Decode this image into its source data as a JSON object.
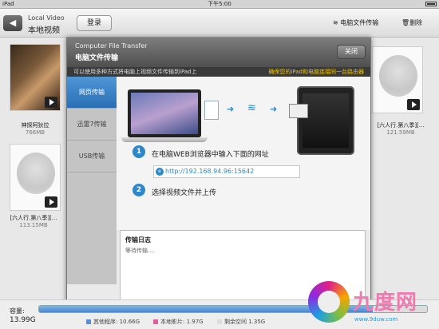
{
  "status_bar": {
    "device": "iPad",
    "time": "下午5:00"
  },
  "header": {
    "back_icon": "back-arrow-icon",
    "subtitle": "Local Video",
    "title": "本地视频",
    "login_label": "登录",
    "pc_transfer_label": "电脑文件传输",
    "delete_label": "删除"
  },
  "library": [
    {
      "name": "神探阿狄拉",
      "size": "766MB"
    },
    {
      "name": "[六人行.第八季][...",
      "size": "121.59MB"
    },
    {
      "name": "[六人行.第八季][...",
      "size": "113.15MB"
    }
  ],
  "modal": {
    "title_en": "Computer File Transfer",
    "title_zh": "电脑文件传输",
    "close_label": "关闭",
    "info_left": "可以使用多种方式将电脑上视频文件传输到iPad上",
    "info_right": "确保您的iPad和电脑连接同一台路由器",
    "tabs": [
      {
        "label": "网页传输",
        "active": true
      },
      {
        "label": "迅雷7传输",
        "active": false
      },
      {
        "label": "USB传输",
        "active": false
      }
    ],
    "step1_num": "1",
    "step1_text": "在电脑WEB浏览器中输入下面的网址",
    "url": "http://192.168.94.96:15642",
    "step2_num": "2",
    "step2_text": "选择视频文件并上传",
    "log_title": "传输日志",
    "log_status": "等待传输...."
  },
  "storage": {
    "label": "容量:",
    "total": "13.99G",
    "used_fraction": 0.86,
    "legend": [
      {
        "label": "其他程序: 10.66G",
        "color": "#5a8fd8"
      },
      {
        "label": "本地影片: 1.97G",
        "color": "#e85aa0"
      },
      {
        "label": "剩余空间 1.35G",
        "color": "#dddddd"
      }
    ]
  },
  "watermark": {
    "name": "九度网",
    "site": "www.9duw.com"
  }
}
